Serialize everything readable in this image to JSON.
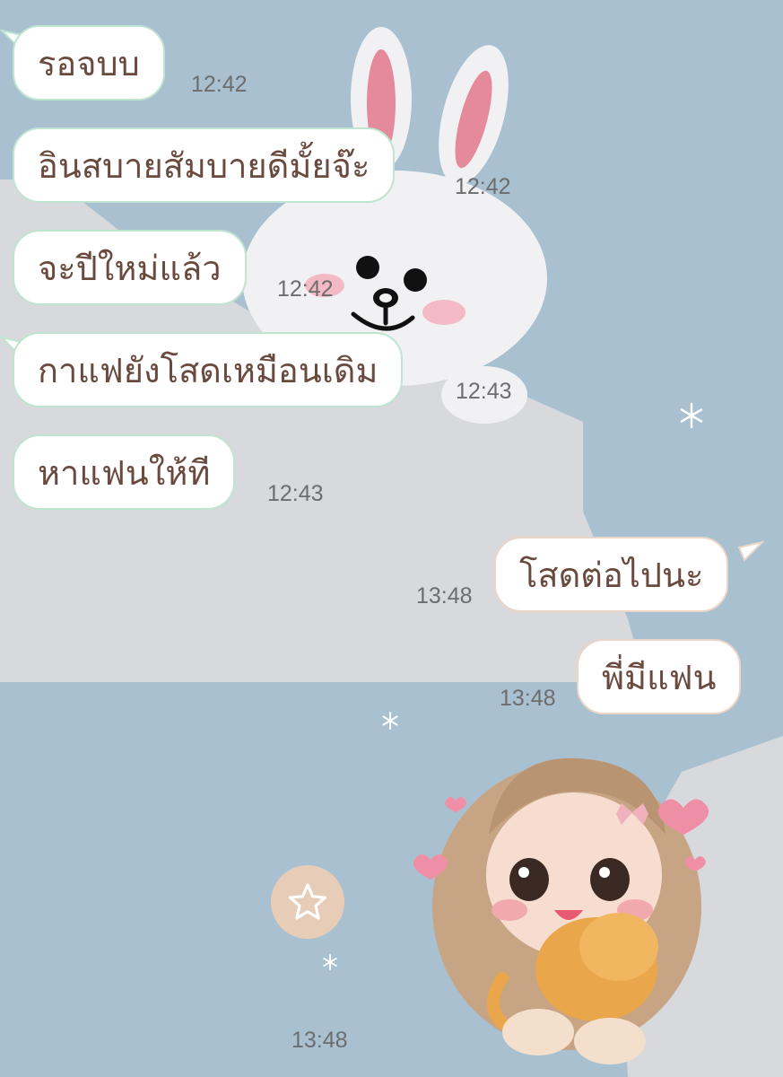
{
  "messages": [
    {
      "text": "รอจบบ",
      "time": "12:42"
    },
    {
      "text": "อินสบายสัมบายดีมั้ยจ๊ะ",
      "time": "12:42"
    },
    {
      "text": "จะปีใหม่แล้ว",
      "time": "12:42"
    },
    {
      "text": "กาแฟยังโสดเหมือนเดิม",
      "time": "12:43"
    },
    {
      "text": "หาแฟนให้ที",
      "time": "12:43"
    },
    {
      "text": "โสดต่อไปนะ",
      "time": "13:48"
    },
    {
      "text": "พี่มีแฟน",
      "time": "13:48"
    },
    {
      "sticker": "girl-with-cat-sticker",
      "time": "13:48"
    }
  ],
  "icons": {
    "favorite": "star-icon",
    "wallpaper": "bunny-wallpaper",
    "decor": "snowflake-icon"
  },
  "colors": {
    "background": "#a9c0d0",
    "text": "#6a4a3e",
    "incoming_border": "#bfe4cf",
    "outgoing_border": "#ead5c7",
    "favorite_button": "#e7cdb7"
  }
}
